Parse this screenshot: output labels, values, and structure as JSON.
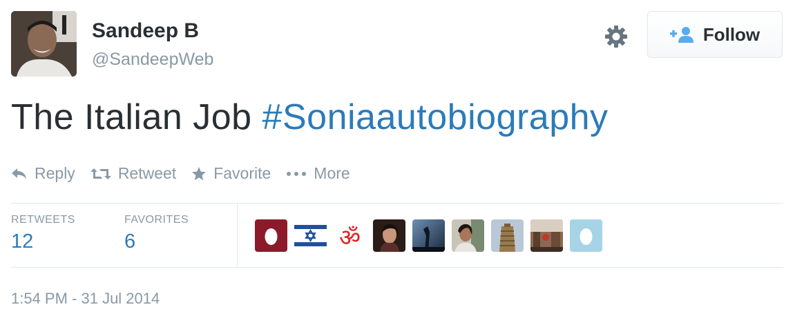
{
  "author": {
    "fullname": "Sandeep B",
    "username": "@SandeepWeb"
  },
  "follow_button": {
    "label": "Follow",
    "icon": "follow-user-icon"
  },
  "settings_icon": "gear-icon",
  "tweet": {
    "text": "The Italian Job ",
    "hashtag": "#Soniaautobiography"
  },
  "actions": [
    {
      "label": "Reply",
      "icon": "reply-icon"
    },
    {
      "label": "Retweet",
      "icon": "retweet-icon"
    },
    {
      "label": "Favorite",
      "icon": "star-icon"
    },
    {
      "label": "More",
      "icon": "more-icon"
    }
  ],
  "stats": {
    "retweets_label": "RETWEETS",
    "retweets_count": "12",
    "favorites_label": "FAVORITES",
    "favorites_count": "6"
  },
  "colors": {
    "link": "#2b7bb9",
    "muted": "#8899a6",
    "text": "#292f33"
  },
  "timestamp": "1:54 PM - 31 Jul 2014"
}
